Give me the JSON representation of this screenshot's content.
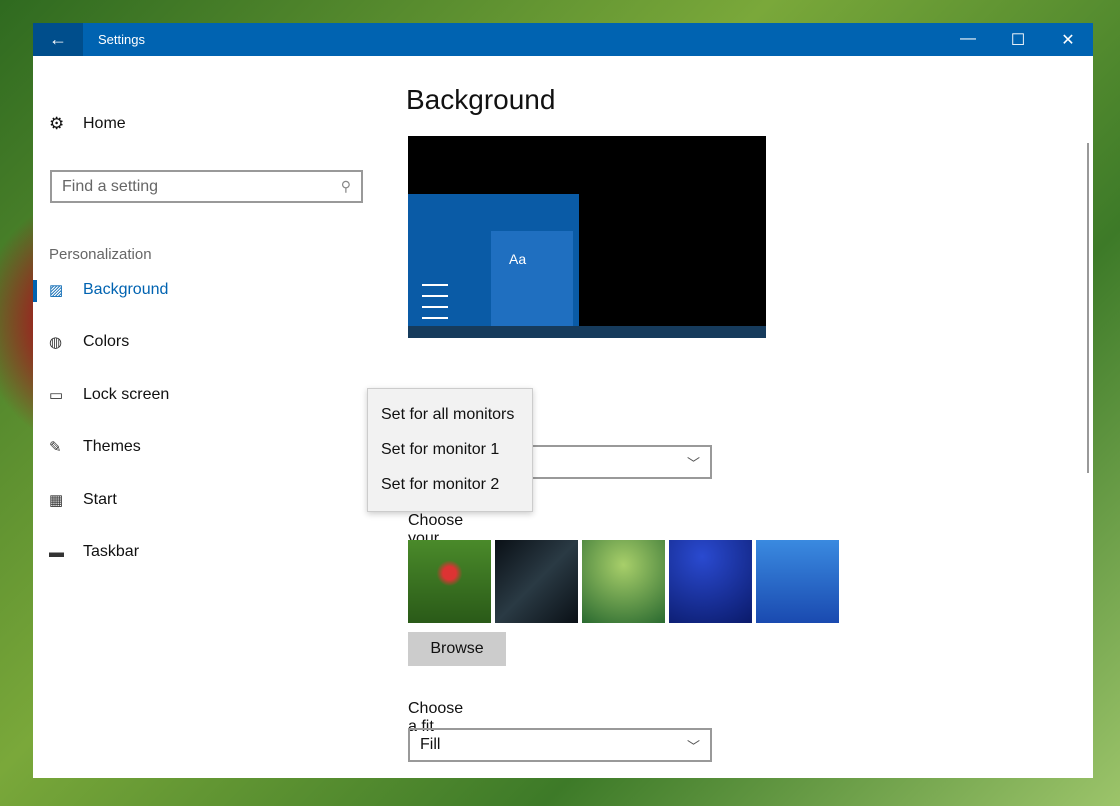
{
  "window": {
    "title": "Settings",
    "minimize": "—",
    "maximize": "☐",
    "close": "✕",
    "back": "←"
  },
  "sidebar": {
    "home": "Home",
    "search_placeholder": "Find a setting",
    "section": "Personalization",
    "items": [
      {
        "label": "Background",
        "icon": "🖼"
      },
      {
        "label": "Colors",
        "icon": "🎨"
      },
      {
        "label": "Lock screen",
        "icon": "▭"
      },
      {
        "label": "Themes",
        "icon": "✎"
      },
      {
        "label": "Start",
        "icon": "▦"
      },
      {
        "label": "Taskbar",
        "icon": "▬"
      }
    ]
  },
  "main": {
    "title": "Background",
    "preview_tile": "Aa",
    "picture_label": "Choose your picture",
    "browse": "Browse",
    "fit_label": "Choose a fit",
    "fit_value": "Fill",
    "thumbnails": [
      "#5a8a2a",
      "#1a2630",
      "#4f8a3a",
      "#0f2a8a",
      "#2a6ad0"
    ]
  },
  "context_menu": [
    "Set for all monitors",
    "Set for monitor 1",
    "Set for monitor 2"
  ],
  "colors": {
    "accent": "#0063b1"
  }
}
